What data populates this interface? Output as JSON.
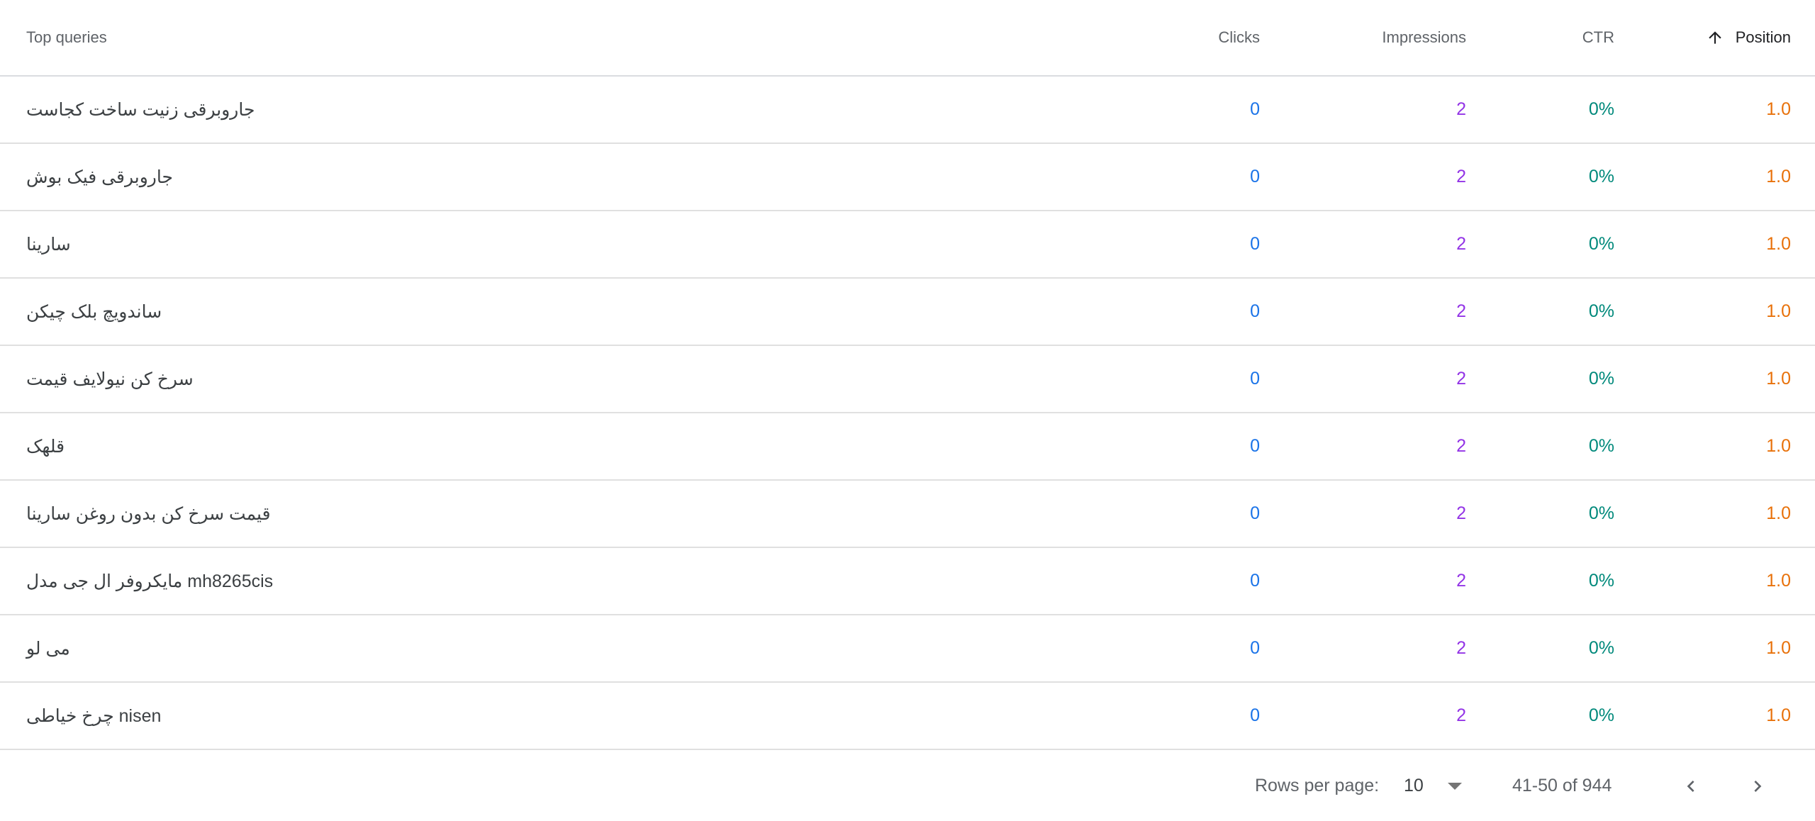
{
  "table": {
    "headers": {
      "query": "Top queries",
      "clicks": "Clicks",
      "impressions": "Impressions",
      "ctr": "CTR",
      "position": "Position"
    },
    "sort_icon": "arrow-up-icon",
    "rows": [
      {
        "query": "جاروبرقی زنیت ساخت کجاست",
        "clicks": "0",
        "impressions": "2",
        "ctr": "0%",
        "position": "1.0"
      },
      {
        "query": "جاروبرقی فیک بوش",
        "clicks": "0",
        "impressions": "2",
        "ctr": "0%",
        "position": "1.0"
      },
      {
        "query": "سارینا",
        "clicks": "0",
        "impressions": "2",
        "ctr": "0%",
        "position": "1.0"
      },
      {
        "query": "ساندویچ بلک چیکن",
        "clicks": "0",
        "impressions": "2",
        "ctr": "0%",
        "position": "1.0"
      },
      {
        "query": "سرخ کن نیولایف قیمت",
        "clicks": "0",
        "impressions": "2",
        "ctr": "0%",
        "position": "1.0"
      },
      {
        "query": "قلهک",
        "clicks": "0",
        "impressions": "2",
        "ctr": "0%",
        "position": "1.0"
      },
      {
        "query": "قیمت سرخ کن بدون روغن سارینا",
        "clicks": "0",
        "impressions": "2",
        "ctr": "0%",
        "position": "1.0"
      },
      {
        "query": "مایکروفر ال جی مدل mh8265cis",
        "clicks": "0",
        "impressions": "2",
        "ctr": "0%",
        "position": "1.0"
      },
      {
        "query": "می لو",
        "clicks": "0",
        "impressions": "2",
        "ctr": "0%",
        "position": "1.0"
      },
      {
        "query": "چرخ خیاطی nisen",
        "clicks": "0",
        "impressions": "2",
        "ctr": "0%",
        "position": "1.0"
      }
    ]
  },
  "footer": {
    "rows_per_page_label": "Rows per page:",
    "rows_per_page_value": "10",
    "range_text": "41-50 of 944",
    "dropdown_icon": "arrow-drop-down-icon",
    "prev_icon": "chevron-left-icon",
    "next_icon": "chevron-right-icon"
  },
  "colors": {
    "clicks": "#1a73e8",
    "impressions": "#9334e6",
    "ctr": "#00897b",
    "position": "#e8710a"
  }
}
